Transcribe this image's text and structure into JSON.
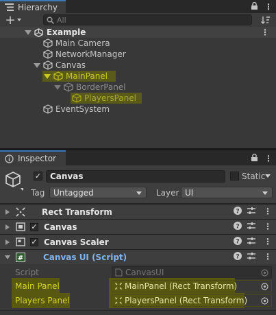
{
  "hierarchy": {
    "tab_label": "Hierarchy",
    "add_label": "+",
    "search_placeholder": "All",
    "scene": {
      "name": "Example"
    },
    "items": [
      {
        "label": "Main Camera"
      },
      {
        "label": "NetworkManager"
      },
      {
        "label": "Canvas"
      },
      {
        "label": "MainPanel"
      },
      {
        "label": "BorderPanel"
      },
      {
        "label": "PlayersPanel"
      },
      {
        "label": "EventSystem"
      }
    ]
  },
  "inspector": {
    "tab_label": "Inspector",
    "object_name": "Canvas",
    "static_label": "Static",
    "tag_label": "Tag",
    "tag_value": "Untagged",
    "layer_label": "Layer",
    "layer_value": "UI",
    "components": [
      {
        "label": "Rect Transform"
      },
      {
        "label": "Canvas"
      },
      {
        "label": "Canvas Scaler"
      },
      {
        "label": "Canvas UI (Script)"
      }
    ],
    "script_label": "Script",
    "script_value": "CanvasUI",
    "fields": [
      {
        "label": "Main Panel",
        "value": "MainPanel (Rect Transform)"
      },
      {
        "label": "Players Panel",
        "value": "PlayersPanel (Rect Transform)"
      }
    ]
  },
  "colors": {
    "highlight": "#5a5a1a",
    "yellow_text": "#d4d428",
    "script_blue": "#82b5f0",
    "accent": "#3a79bb"
  }
}
